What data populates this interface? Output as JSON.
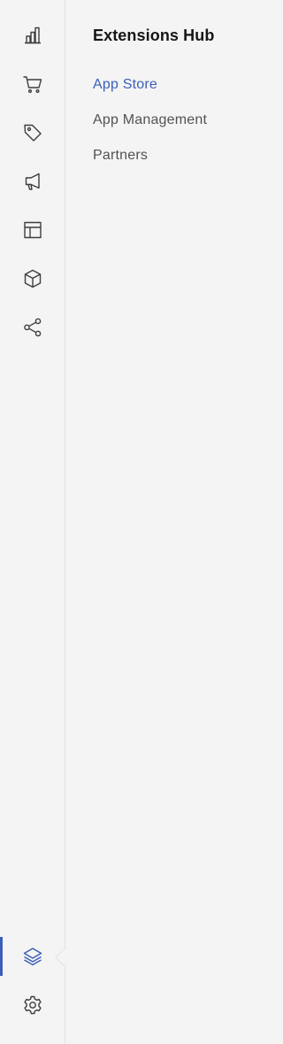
{
  "theme": {
    "accent": "#3b5fb8",
    "icon_color": "#3d3d3d"
  },
  "rail": {
    "items": [
      {
        "icon": "bar-chart-icon",
        "label": ""
      },
      {
        "icon": "shopping-cart-icon",
        "label": ""
      },
      {
        "icon": "tag-icon",
        "label": ""
      },
      {
        "icon": "megaphone-icon",
        "label": ""
      },
      {
        "icon": "layout-icon",
        "label": ""
      },
      {
        "icon": "cube-icon",
        "label": ""
      },
      {
        "icon": "share-icon",
        "label": ""
      },
      {
        "icon": "layers-icon",
        "label": "",
        "active": true
      },
      {
        "icon": "gear-icon",
        "label": ""
      }
    ]
  },
  "panel": {
    "title": "Extensions Hub",
    "links": [
      {
        "label": "App Store",
        "selected": true
      },
      {
        "label": "App Management",
        "selected": false
      },
      {
        "label": "Partners",
        "selected": false
      }
    ]
  }
}
